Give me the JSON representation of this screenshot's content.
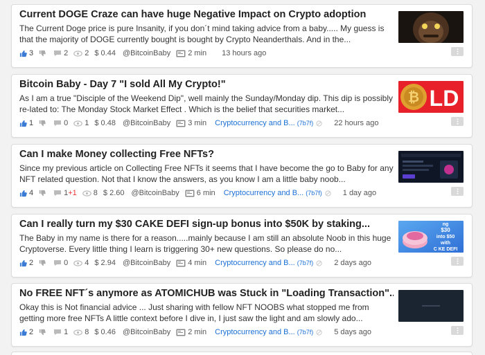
{
  "posts": [
    {
      "title": "Current DOGE Craze can have huge Negative Impact on Crypto adoption",
      "excerpt": "The Current Doge price is pure Insanity, if you don´t mind taking advice from a baby..... My guess is that the majority of DOGE currently bought is bought by Crypto Neanderthals. And in the...",
      "upvotes": "3",
      "comments": "2",
      "comments_new": "",
      "views": "2",
      "payout": "$ 0.44",
      "author": "@BitcoinBaby",
      "read_time": "2 min",
      "category": "",
      "category_id": "",
      "age": "13 hours ago"
    },
    {
      "title": "Bitcoin Baby - Day 7 \"I sold All My Crypto!\"",
      "excerpt": "As I am a true \"Disciple of the Weekend Dip\", well mainly the Sunday/Monday dip. This dip is possibly re-lated to: The Monday Stock Market Effect . Which is the belief that securities market...",
      "upvotes": "1",
      "comments": "0",
      "comments_new": "",
      "views": "1",
      "payout": "$ 0.48",
      "author": "@BitcoinBaby",
      "read_time": "3 min",
      "category": "Cryptocurrency and B...",
      "category_id": "(7b7f)",
      "age": "22 hours ago"
    },
    {
      "title": "Can I make Money collecting Free NFTs?",
      "excerpt": "Since my previous article on  Collecting Free NFTs  it seems that I have become the go to Baby for any NFT related question. Not that I know the answers, as you know I am a little baby noob...",
      "upvotes": "4",
      "comments": "1",
      "comments_new": "+1",
      "views": "8",
      "payout": "$ 2.60",
      "author": "@BitcoinBaby",
      "read_time": "6 min",
      "category": "Cryptocurrency and B...",
      "category_id": "(7b7f)",
      "age": "1 day ago"
    },
    {
      "title": "Can I really turn my $30 CAKE DEFI sign-up bonus into $50K by staking...",
      "excerpt": "The Baby in my name is there for a reason.....mainly because I am still an absolute Noob in this huge Cryptoverse. Every little thing I learn is triggering 30+ new questions. So please do no...",
      "upvotes": "2",
      "comments": "0",
      "comments_new": "",
      "views": "4",
      "payout": "$ 2.94",
      "author": "@BitcoinBaby",
      "read_time": "4 min",
      "category": "Cryptocurrency and B...",
      "category_id": "(7b7f)",
      "age": "2 days ago"
    },
    {
      "title": "No FREE NFT´s anymore as ATOMICHUB was Stuck in \"Loading Transaction\"...",
      "excerpt": "Okay this is Not financial advice ... Just sharing with fellow NFT NOOBS what stopped me from getting more free NFTs A little context before I dive in, I just saw the light and am slowly ado...",
      "upvotes": "2",
      "comments": "1",
      "comments_new": "",
      "views": "8",
      "payout": "$ 0.46",
      "author": "@BitcoinBaby",
      "read_time": "2 min",
      "category": "Cryptocurrency and B...",
      "category_id": "(7b7f)",
      "age": "5 days ago"
    }
  ],
  "thumbs": {
    "t2_letters": "LD",
    "t4_lines": [
      "ng",
      "$30",
      "into $50",
      "with",
      "C KE DEFI"
    ]
  },
  "colors": {
    "link_blue": "#1a6fd6",
    "upvote_blue": "#3a7bd5",
    "new_comment_red": "#ee3333"
  },
  "icons": [
    "thumbs-up-icon",
    "thumbs-down-icon",
    "comment-icon",
    "eye-icon",
    "clock-icon",
    "info-circle-icon",
    "more-icon"
  ]
}
